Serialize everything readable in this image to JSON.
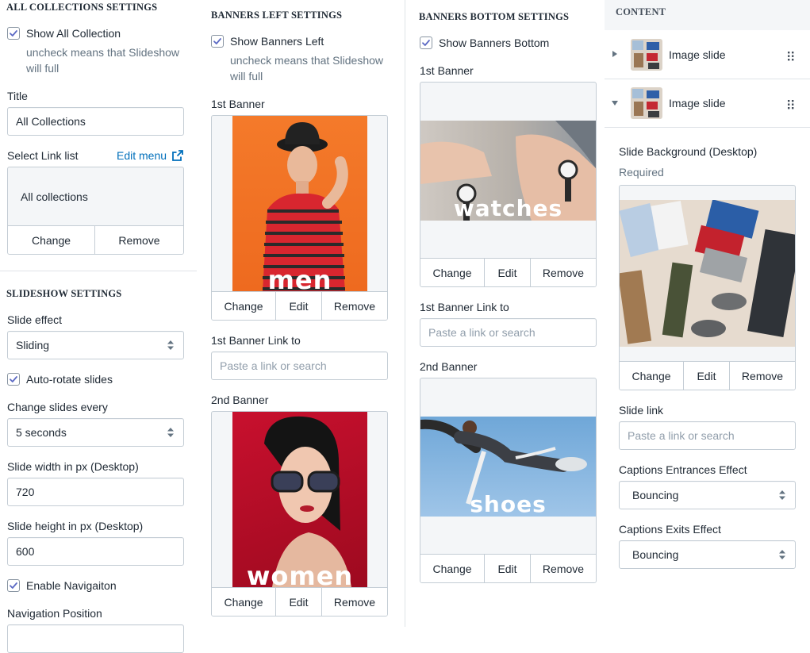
{
  "collections": {
    "section_title": "ALL COLLECTIONS SETTINGS",
    "show_label": "Show All Collection",
    "show_help": "uncheck means that Slideshow will full",
    "title_label": "Title",
    "title_value": "All Collections",
    "link_list_label": "Select Link list",
    "edit_menu": "Edit menu",
    "link_list_value": "All collections",
    "change": "Change",
    "remove": "Remove"
  },
  "slideshow": {
    "section_title": "SLIDESHOW SETTINGS",
    "effect_label": "Slide effect",
    "effect_value": "Sliding",
    "autorotate_label": "Auto-rotate slides",
    "change_every_label": "Change slides every",
    "change_every_value": "5 seconds",
    "width_label": "Slide width in px (Desktop)",
    "width_value": "720",
    "height_label": "Slide height in px (Desktop)",
    "height_value": "600",
    "nav_label": "Enable Navigaiton",
    "nav_position_label": "Navigation Position"
  },
  "banners_left": {
    "section_title": "BANNERS LEFT SETTINGS",
    "show_label": "Show Banners Left",
    "show_help": "uncheck means that Slideshow will full",
    "first_label": "1st Banner",
    "first_image_text": "men",
    "first_link_label": "1st Banner Link to",
    "first_link_placeholder": "Paste a link or search",
    "second_label": "2nd Banner",
    "second_image_text": "women",
    "change": "Change",
    "edit": "Edit",
    "remove": "Remove"
  },
  "banners_bottom": {
    "section_title": "BANNERS BOTTOM SETTINGS",
    "show_label": "Show Banners Bottom",
    "first_label": "1st Banner",
    "first_image_text": "watches",
    "first_link_label": "1st Banner Link to",
    "first_link_placeholder": "Paste a link or search",
    "second_label": "2nd Banner",
    "second_image_text": "shoes",
    "change": "Change",
    "edit": "Edit",
    "remove": "Remove"
  },
  "content": {
    "section_title": "CONTENT",
    "blocks": [
      {
        "label": "Image slide",
        "expanded": false
      },
      {
        "label": "Image slide",
        "expanded": true
      }
    ],
    "bg_label": "Slide Background (Desktop)",
    "bg_required": "Required",
    "change": "Change",
    "edit": "Edit",
    "remove": "Remove",
    "slide_link_label": "Slide link",
    "slide_link_placeholder": "Paste a link or search",
    "entrance_label": "Captions Entrances Effect",
    "entrance_value": "Bouncing",
    "exit_label": "Captions Exits Effect",
    "exit_value": "Bouncing"
  },
  "colors": {
    "accent": "#006fbb",
    "border": "#c4cdd5",
    "checkbox_check": "#5c6ac4"
  }
}
